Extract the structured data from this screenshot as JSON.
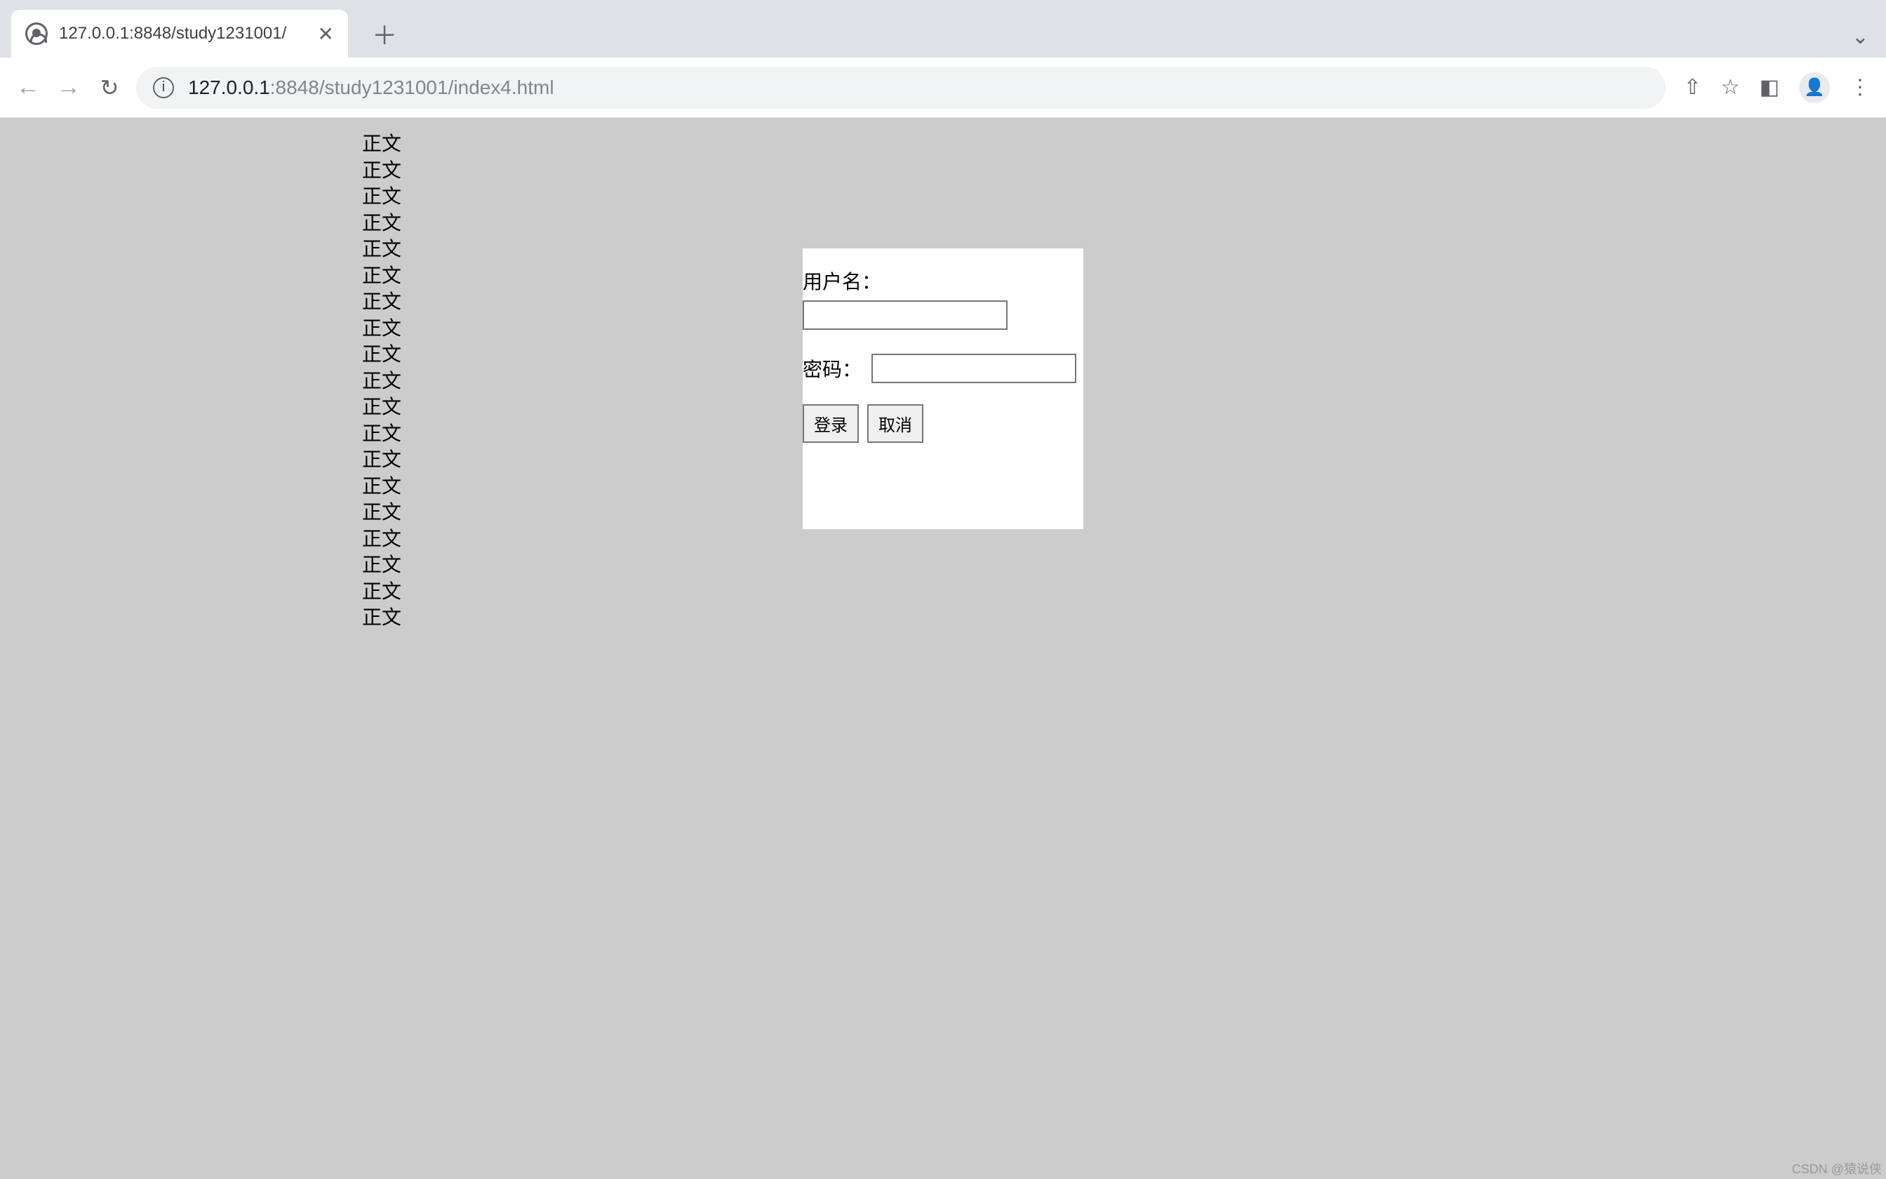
{
  "browser": {
    "tab_title": "127.0.0.1:8848/study1231001/",
    "url_host_dim": "127.0.0.1",
    "url_port": ":8848",
    "url_path": "/study1231001/index4.html",
    "icons": {
      "back": "←",
      "forward": "→",
      "reload": "↻",
      "info": "i",
      "share": "⇧",
      "bookmark": "☆",
      "sidepanel": "◧",
      "profile": "👤",
      "menu": "⋮",
      "close": "✕",
      "newtab": "＋",
      "chevron": "⌄"
    }
  },
  "page": {
    "body_line": "正文",
    "body_line_count": 19,
    "login": {
      "username_label": "用户名：",
      "password_label": "密码：",
      "username_value": "",
      "password_value": "",
      "login_btn": "登录",
      "cancel_btn": "取消"
    },
    "watermark": "CSDN @猿说侠"
  }
}
